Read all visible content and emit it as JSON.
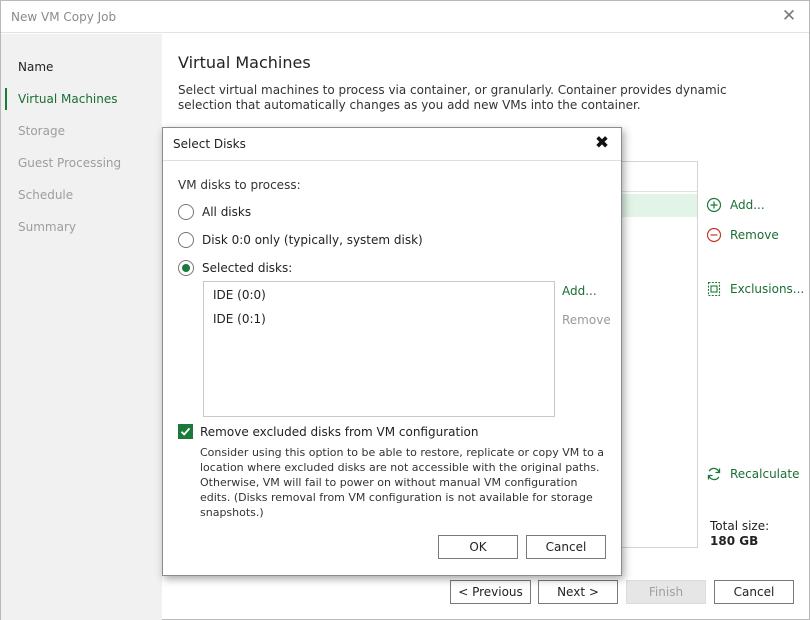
{
  "window": {
    "title": "New VM Copy Job",
    "close_glyph": "✕"
  },
  "sidebar": {
    "items": [
      {
        "label": "Name",
        "state": "done"
      },
      {
        "label": "Virtual Machines",
        "state": "active"
      },
      {
        "label": "Storage",
        "state": "pending"
      },
      {
        "label": "Guest Processing",
        "state": "pending"
      },
      {
        "label": "Schedule",
        "state": "pending"
      },
      {
        "label": "Summary",
        "state": "pending"
      }
    ]
  },
  "main": {
    "title": "Virtual Machines",
    "description": "Select virtual machines to process via container, or granularly. Container provides dynamic selection that automatically changes as you add new VMs into the container.",
    "actions": {
      "add": "Add...",
      "remove": "Remove",
      "exclusions": "Exclusions...",
      "recalculate": "Recalculate"
    },
    "total_size_label": "Total size:",
    "total_size_value": "180 GB"
  },
  "footer": {
    "previous": "< Previous",
    "next": "Next >",
    "finish": "Finish",
    "cancel": "Cancel"
  },
  "dialog": {
    "title": "Select Disks",
    "close_glyph": "✖",
    "prompt": "VM disks to process:",
    "options": [
      {
        "label": "All disks",
        "checked": false
      },
      {
        "label": "Disk 0:0 only (typically, system disk)",
        "checked": false
      },
      {
        "label": "Selected disks:",
        "checked": true
      }
    ],
    "disks": [
      "IDE (0:0)",
      "IDE (0:1)"
    ],
    "add_link": "Add...",
    "remove_link": "Remove",
    "checkbox_label": "Remove excluded disks from VM configuration",
    "checkbox_checked": true,
    "note": "Consider using this option to be able to restore, replicate or copy VM to a location where excluded disks are not accessible with the original paths. Otherwise, VM will fail to power on without manual VM configuration edits. (Disks removal from VM configuration is not available for storage snapshots.)",
    "ok": "OK",
    "cancel": "Cancel"
  },
  "colors": {
    "accent": "#1a7a3a",
    "danger": "#b03030",
    "selection": "#e2f4e7"
  }
}
